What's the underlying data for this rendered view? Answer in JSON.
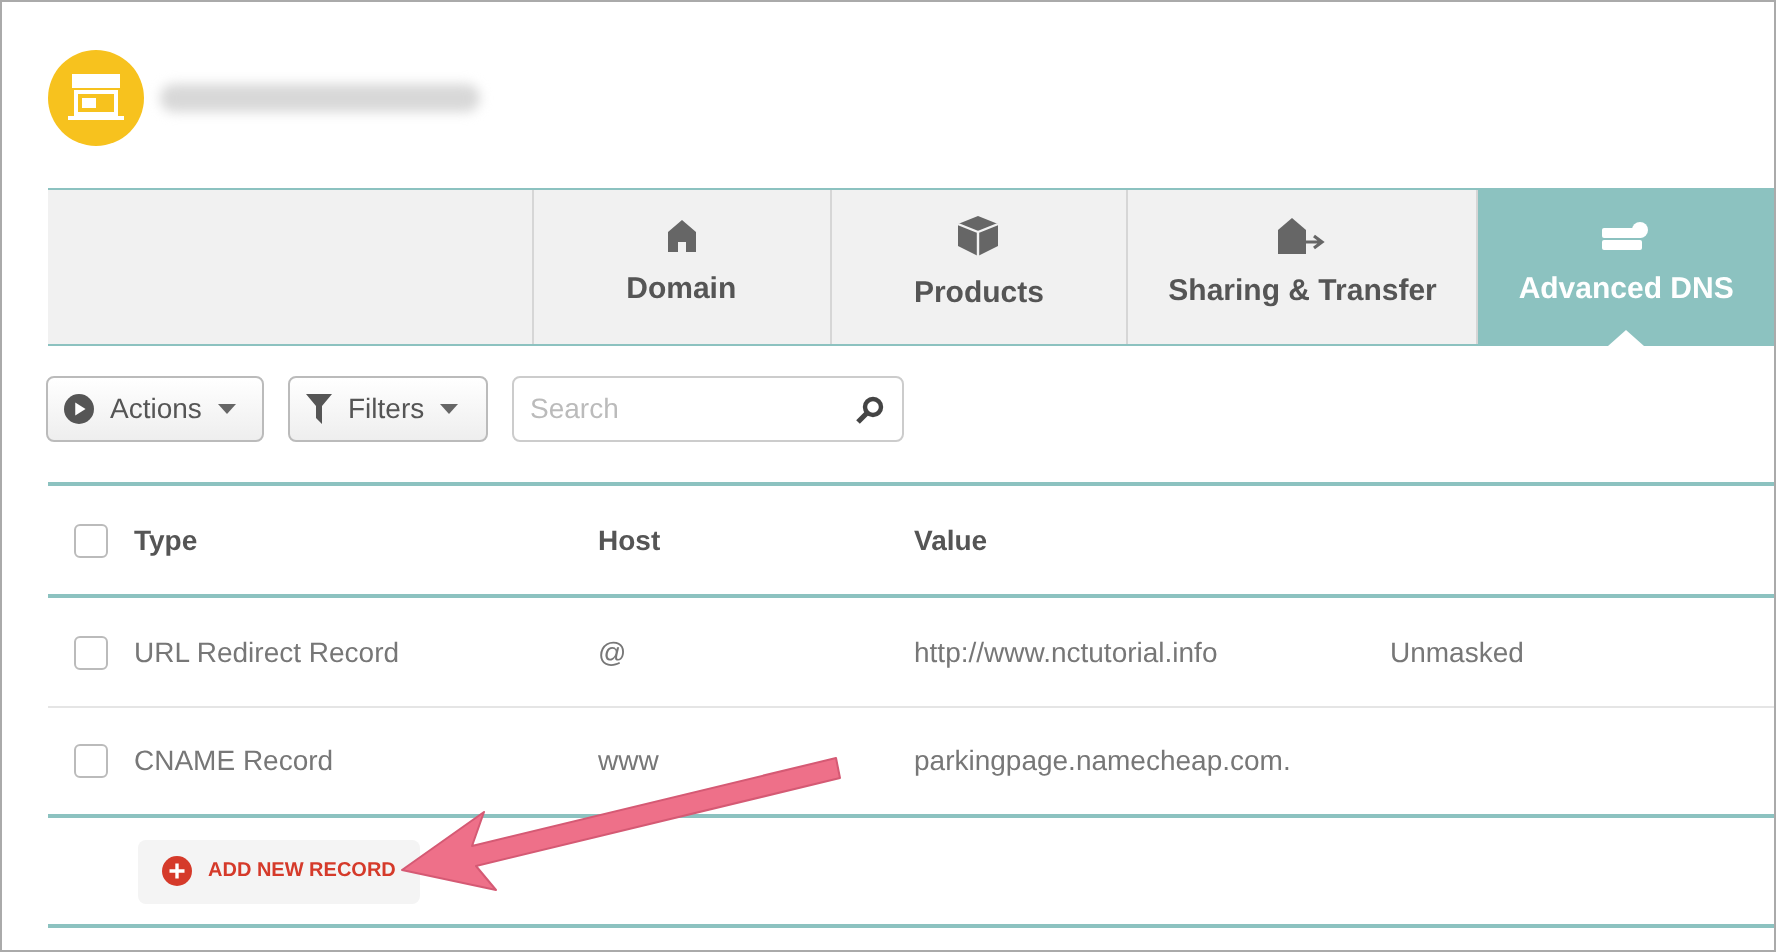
{
  "tabs": [
    {
      "label": "Domain",
      "kind": "home",
      "selected": false
    },
    {
      "label": "Products",
      "kind": "box",
      "selected": false
    },
    {
      "label": "Sharing & Transfer",
      "kind": "transfer",
      "selected": false
    },
    {
      "label": "Advanced DNS",
      "kind": "server",
      "selected": true
    }
  ],
  "toolbar": {
    "actions": "Actions",
    "filters": "Filters",
    "search": {
      "placeholder": "Search"
    }
  },
  "table": {
    "select_all": {
      "checked": false
    },
    "columns": [
      "Type",
      "Host",
      "Value"
    ],
    "rows": [
      {
        "checked": false,
        "cells": [
          "URL Redirect Record",
          "@",
          "http://www.nctutorial.info",
          "Unmasked"
        ]
      },
      {
        "checked": false,
        "cells": [
          "CNAME Record",
          "www",
          "parkingpage.namecheap.com."
        ]
      }
    ]
  },
  "add_button": "ADD NEW RECORD"
}
